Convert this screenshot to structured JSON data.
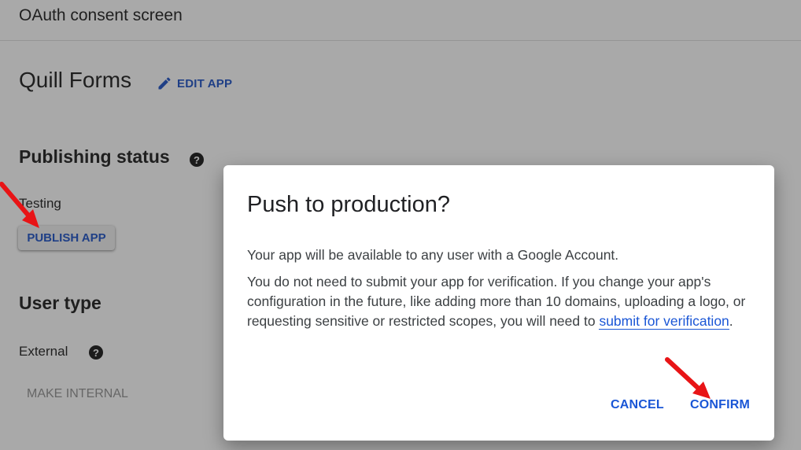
{
  "header": {
    "title": "OAuth consent screen"
  },
  "app": {
    "name": "Quill Forms",
    "edit_label": "EDIT APP"
  },
  "publishing": {
    "title": "Publishing status",
    "help_glyph": "?",
    "status": "Testing",
    "publish_label": "PUBLISH APP"
  },
  "user_type": {
    "title": "User type",
    "value": "External",
    "help_glyph": "?",
    "make_internal_label": "MAKE INTERNAL"
  },
  "dialog": {
    "title": "Push to production?",
    "paragraph1": "Your app will be available to any user with a Google Account.",
    "paragraph2_text": "You do not need to submit your app for verification. If you change your app's configuration in the future, like adding more than 10 domains, uploading a logo, or requesting sensitive or restricted scopes, you will need to ",
    "paragraph2_link": "submit for verification",
    "paragraph2_end": ".",
    "cancel_label": "CANCEL",
    "confirm_label": "CONFIRM"
  },
  "colors": {
    "overlay_bg": "#a9a9a9",
    "accent_link": "#1a56d6",
    "dim_accent": "#1f3f86",
    "annotation_arrow": "#e81416"
  },
  "icons": {
    "edit": "pencil-icon",
    "help": "help-circle-icon",
    "annotation": "red-arrow-icon"
  }
}
